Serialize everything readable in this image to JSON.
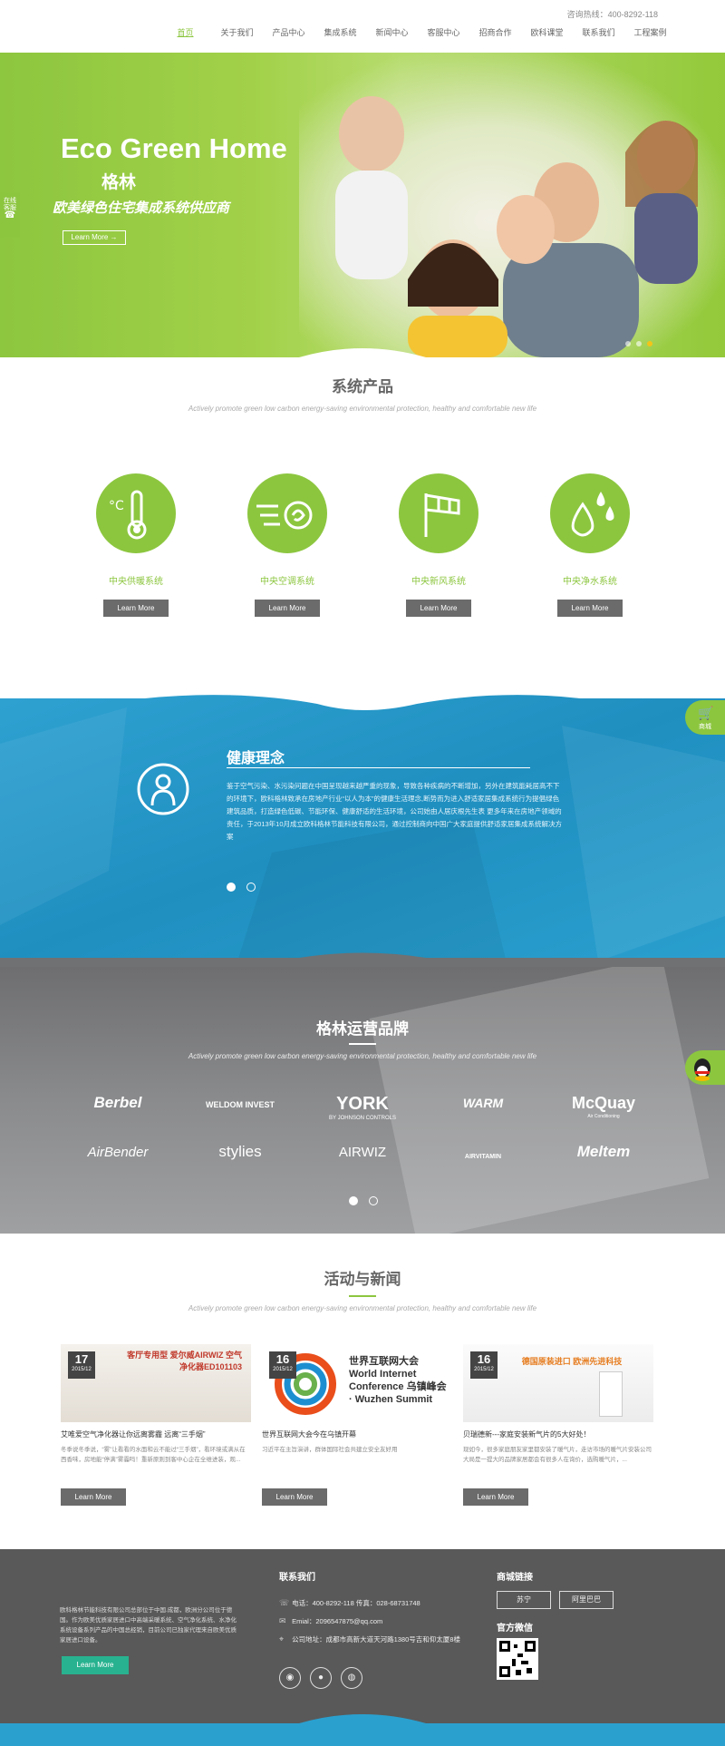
{
  "header": {
    "hotline": "咨询热线：400-8292-118",
    "nav": [
      "首页",
      "关于我们",
      "产品中心",
      "集成系统",
      "新闻中心",
      "客服中心",
      "招商合作",
      "欧科课堂",
      "联系我们",
      "工程案例"
    ]
  },
  "hero": {
    "title": "Eco Green Home",
    "brand": "格林",
    "tagline": "欧美绿色住宅集成系统供应商",
    "button": "Learn More →",
    "side_tab": "在线客服"
  },
  "products": {
    "title": "系统产品",
    "subtitle": "Actively promote green low carbon energy-saving environmental protection, healthy and comfortable new life",
    "items": [
      {
        "label": "中央供暖系统",
        "button": "Learn More",
        "icon": "thermometer-icon"
      },
      {
        "label": "中央空调系统",
        "button": "Learn More",
        "icon": "airflow-icon"
      },
      {
        "label": "中央新风系统",
        "button": "Learn More",
        "icon": "windsock-icon"
      },
      {
        "label": "中央净水系统",
        "button": "Learn More",
        "icon": "water-drop-icon"
      }
    ]
  },
  "health": {
    "title": "健康理念",
    "body": "鉴于空气污染、水污染问题在中国呈现越来越严重的现象，导致各种疾病的不断增加，另外在建筑能耗居高不下的环境下，欧科格林致承在房地产行业“以人为本”的健康生活理念,断势而为进入舒适家居集成系统行为提倡绿色建筑品质，打造绿色低碳、节能环保、健康舒适的生活环境，公司始由人居庆根先生表 更多年来在房地产领域的责任，于2013年10月成立欧科格林节能科技有限公司，通过控制商向中国广大家庭提供舒适家居集成系统解决方案",
    "cart_label": "商城"
  },
  "brands": {
    "title": "格林运营品牌",
    "subtitle": "Actively promote green low carbon energy-saving environmental protection, healthy and comfortable new life",
    "logos": [
      "Berbel",
      "WELDOM INVEST",
      "YORK",
      "WARM",
      "McQuay",
      "AirBender",
      "stylies",
      "AIRWIZ",
      "AIRVITAMIN",
      "Meltem"
    ],
    "logo_subs": {
      "YORK": "BY JOHNSON CONTROLS",
      "McQuay": "Air Conditioning"
    }
  },
  "news": {
    "title": "活动与新闻",
    "subtitle": "Actively promote green low carbon energy-saving environmental protection, healthy and comfortable new life",
    "items": [
      {
        "day": "17",
        "ym": "2015/12",
        "title": "艾唯爱空气净化器让你远离雾霾 远离“三手烟”",
        "text": "冬季说冬季说，“雾”让看看的水面和云不能过“三手烟”，看环境或满从在西香味，房地能“停满”雾霾吗！重新原则到客中心企在全维进装，观...",
        "button": "Learn More",
        "img_text": "客厅专用型 爱尔威AIRWIZ 空气净化器ED101103"
      },
      {
        "day": "16",
        "ym": "2015/12",
        "title": "世界互联网大会今在乌镇开幕",
        "text": "习近平在主旨演讲，群体国际社会共建立安全友好用",
        "button": "Learn More",
        "img_text": "世界互联网大会 World Internet Conference 乌镇峰会 · Wuzhen Summit"
      },
      {
        "day": "16",
        "ym": "2015/12",
        "title": "贝瑞德新---家庭安装新气片的5大好处！",
        "text": "现如今，很多家庭朋友家里都安装了暖气片，走访市场的暖气片安装公司大局是一提大的品牌家居都会有很多人在询价，选购暖气片，...",
        "button": "Learn More",
        "img_text": "德国原装进口 欧洲先进科技"
      }
    ]
  },
  "footer": {
    "about": "欧科格林节能科技有限公司总部位于中国.成都，欧洲分公司位于德国。作为欧美优质家居进口中高端采暖系统、空气净化系统、水净化系统设备系列产品的中国总经销，目前公司已独家代理来自欧美优质家居进口设备。",
    "about_button": "Learn More",
    "contact_title": "联系我们",
    "phone": "电话：400-8292-118 传真：028-68731748",
    "email": "Emial：2096547875@qq.com",
    "address": "公司地址：成都市高新大道天河路1380号吉和仰太厦8楼",
    "links_title": "商城链接",
    "links": [
      "苏宁",
      "阿里巴巴"
    ],
    "wechat_title": "官方微信",
    "social": [
      "weibo-icon",
      "qq-icon",
      "wechat-icon"
    ]
  }
}
